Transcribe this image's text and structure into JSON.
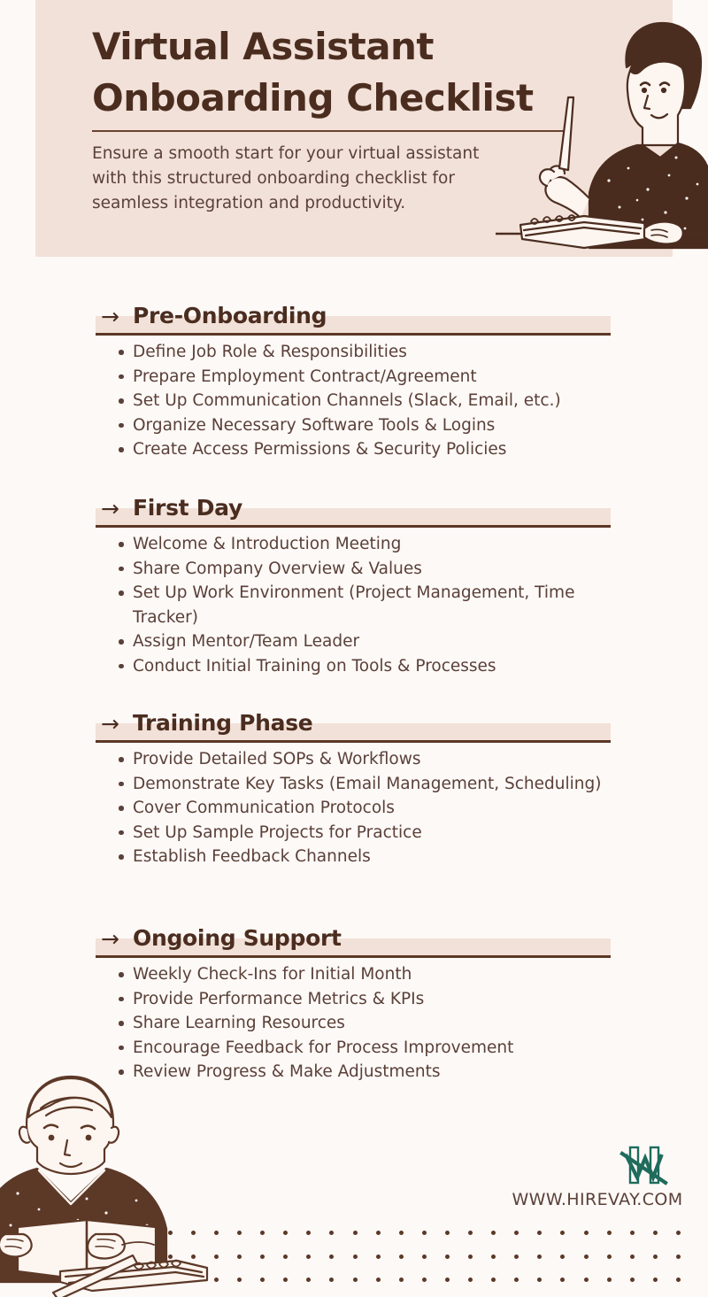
{
  "header": {
    "title_line1": "Virtual Assistant",
    "title_line2": "Onboarding Checklist",
    "subtitle": "Ensure a smooth start for your virtual assistant with this structured onboarding checklist for seamless integration and productivity.",
    "band_color": "#F2E1D8",
    "title_color": "#4B2D20"
  },
  "colors": {
    "page_background": "#FDF9F7",
    "accent_pink": "#F2E1D8",
    "dark_brown": "#4B2D20",
    "body_brown": "#5A4038",
    "logo_teal": "#1F6B5C"
  },
  "sections": [
    {
      "arrow": "→",
      "title": "Pre-Onboarding",
      "items": [
        "Define Job Role & Responsibilities",
        "Prepare Employment Contract/Agreement",
        "Set Up Communication Channels (Slack, Email, etc.)",
        "Organize Necessary Software Tools & Logins",
        "Create Access Permissions & Security Policies"
      ]
    },
    {
      "arrow": "→",
      "title": "First Day",
      "items": [
        "Welcome & Introduction Meeting",
        "Share Company Overview & Values",
        "Set Up Work Environment (Project Management, Time Tracker)",
        "Assign Mentor/Team Leader",
        "Conduct Initial Training on Tools & Processes"
      ]
    },
    {
      "arrow": "→",
      "title": "Training Phase",
      "items": [
        "Provide Detailed SOPs & Workflows",
        "Demonstrate Key Tasks (Email Management, Scheduling)",
        "Cover Communication Protocols",
        "Set Up Sample Projects for Practice",
        "Establish Feedback Channels"
      ]
    },
    {
      "arrow": "→",
      "title": "Ongoing Support",
      "items": [
        "Weekly Check-Ins for Initial Month",
        "Provide Performance Metrics & KPIs",
        "Share Learning Resources",
        "Encourage Feedback for Process Improvement",
        "Review Progress & Make Adjustments"
      ]
    }
  ],
  "footer": {
    "url": "WWW.HIREVAY.COM",
    "logo_name": "hirevay-h-logo"
  },
  "illustrations": {
    "top": "person-pointing-with-pen-at-desk",
    "bottom": "person-reading-open-book-at-desk"
  }
}
